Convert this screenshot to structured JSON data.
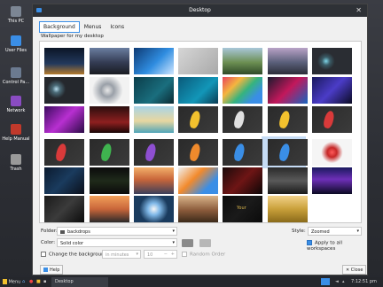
{
  "desktop_icons": [
    {
      "label": "This PC",
      "color": "#7c8694"
    },
    {
      "label": "User Files",
      "color": "#3a8ee6"
    },
    {
      "label": "Control Pa...",
      "color": "#6b7a90"
    },
    {
      "label": "Network",
      "color": "#8a4cc2"
    },
    {
      "label": "Help Manual",
      "color": "#c0392b"
    },
    {
      "label": "Trash",
      "color": "#9a9a9a"
    }
  ],
  "window": {
    "title": "Desktop",
    "tabs": [
      "Background",
      "Menus",
      "Icons"
    ],
    "active_tab": "Background",
    "wallpaper_label": "Wallpaper for my desktop"
  },
  "wallpapers": [
    {
      "name": "city-lights",
      "bg": "linear-gradient(180deg,#0b1526,#23395d 60%,#b37a2c)"
    },
    {
      "name": "mountain-dusk",
      "bg": "linear-gradient(180deg,#6a7ea0,#343c54 55%,#1a1c22)"
    },
    {
      "name": "blue-wave",
      "bg": "linear-gradient(135deg,#0e3a73,#2f8de0 55%,#cfe6ff)"
    },
    {
      "name": "gray-blur",
      "bg": "linear-gradient(135deg,#d6d6d6,#a9a9a9)"
    },
    {
      "name": "green-hills",
      "bg": "linear-gradient(180deg,#a9c7d9,#6c8f52 55%,#2f4a28)"
    },
    {
      "name": "purple-peak",
      "bg": "linear-gradient(180deg,#b9a3c7,#5a5f7a 55%,#2b2d38)"
    },
    {
      "name": "dark-orb",
      "bg": "radial-gradient(circle at 35% 50%,#7fd6e8 0,#3a5b66 14%,#2a2d33 30%)"
    },
    {
      "name": "dark-blue-orb",
      "bg": "radial-gradient(circle at 30% 45%,#b9dff0 0,#4b6b78 12%,#25282d 30%)"
    },
    {
      "name": "robot-hand",
      "bg": "radial-gradient(circle at 45% 50%,#e8e8e8 0,#9aa0a8 25%,#f2f2f2 60%)"
    },
    {
      "name": "teal-dark",
      "bg": "linear-gradient(135deg,#0b3d4a,#1a6e7e 60%,#0b2a33)"
    },
    {
      "name": "teal-blue",
      "bg": "linear-gradient(135deg,#0a5a7a,#1296b8 60%,#0a3b52)"
    },
    {
      "name": "colorful-face",
      "bg": "linear-gradient(135deg,#e8455f,#f4b53f 30%,#36b37e 55%,#3a8ee6 80%)"
    },
    {
      "name": "pink-dots",
      "bg": "linear-gradient(135deg,#1a1a2e,#c2185b 50%,#1565c0)"
    },
    {
      "name": "blue-purple-abstract",
      "bg": "linear-gradient(135deg,#1a1a5e,#4b3cc7 50%,#0b0b24)"
    },
    {
      "name": "magenta-lines",
      "bg": "linear-gradient(135deg,#3a0b5e,#b82fd1 50%,#2b0b46)"
    },
    {
      "name": "red-forest",
      "bg": "linear-gradient(180deg,#2a0e0e,#8e1f1f 60%,#1a0606)"
    },
    {
      "name": "beach",
      "bg": "linear-gradient(180deg,#a8d4e8,#e8d7a0 55%,#4fa4b8)"
    },
    {
      "name": "yellow-stroke",
      "bg": "linear-gradient(135deg,#2a2a2a,#3b3b3b)",
      "accent": "#f2c12e"
    },
    {
      "name": "gray-stroke",
      "bg": "linear-gradient(135deg,#2a2a2a,#3b3b3b)",
      "accent": "#e0e0e0"
    },
    {
      "name": "yellow-stroke-2",
      "bg": "linear-gradient(135deg,#2a2a2a,#3b3b3b)",
      "accent": "#f2c12e"
    },
    {
      "name": "red-stroke",
      "bg": "linear-gradient(135deg,#2a2a2a,#3b3b3b)",
      "accent": "#d93a3a"
    },
    {
      "name": "red-stroke-2",
      "bg": "linear-gradient(135deg,#2a2a2a,#3b3b3b)",
      "accent": "#d93a3a"
    },
    {
      "name": "green-stroke",
      "bg": "linear-gradient(135deg,#2a2a2a,#3b3b3b)",
      "accent": "#3fb34f"
    },
    {
      "name": "purple-stroke",
      "bg": "linear-gradient(135deg,#2a2a2a,#3b3b3b)",
      "accent": "#8e4fd1"
    },
    {
      "name": "orange-stroke",
      "bg": "linear-gradient(135deg,#2a2a2a,#3b3b3b)",
      "accent": "#f08a2c"
    },
    {
      "name": "blue-stroke",
      "bg": "linear-gradient(135deg,#2a2a2a,#3b3b3b)",
      "accent": "#3a8ee6"
    },
    {
      "name": "blue-stroke-selected",
      "bg": "linear-gradient(135deg,#2a2a2a,#3b3b3b)",
      "accent": "#3a8ee6",
      "selected": true
    },
    {
      "name": "red-heart",
      "bg": "radial-gradient(circle at 50% 50%,#ff5a5a 0,#c62828 20%,#f5f5f5 45%)"
    },
    {
      "name": "dark-tech",
      "bg": "linear-gradient(135deg,#0b1a2e,#1a3b5e 50%,#0b0f1a)"
    },
    {
      "name": "code-screen",
      "bg": "linear-gradient(180deg,#0b0b0b,#1f2a1a 50%,#0b0b0b)"
    },
    {
      "name": "sunset-mountain",
      "bg": "linear-gradient(180deg,#f2b06a,#c9663a 45%,#3b3f5a)"
    },
    {
      "name": "orange-feather",
      "bg": "linear-gradient(135deg,#f0f0f0,#f28a2c 40%,#3a8ee6 75%)"
    },
    {
      "name": "dark-red-glow",
      "bg": "linear-gradient(135deg,#1a0b0b,#6e1515 50%,#0b0606)"
    },
    {
      "name": "dark-cave",
      "bg": "linear-gradient(180deg,#2a2a2a,#5a5a5a 50%,#1a1a1a)"
    },
    {
      "name": "city-night-reflection",
      "bg": "linear-gradient(180deg,#1a1a5e,#6e2fb8 45%,#0b0b24)"
    },
    {
      "name": "dark-pattern",
      "bg": "linear-gradient(135deg,#1a1a1a,#3b3b3b 50%,#0b0b0b)"
    },
    {
      "name": "stonehenge",
      "bg": "linear-gradient(180deg,#f2a05a,#c9663a 50%,#2b2a2a)"
    },
    {
      "name": "blue-tunnel",
      "bg": "radial-gradient(circle at 50% 50%,#f5f5f5 0,#7fb8e8 25%,#1a3b5e 60%)"
    },
    {
      "name": "brown-hall",
      "bg": "linear-gradient(180deg,#d9b48a,#8a5a3a 55%,#3b2a1a)"
    },
    {
      "name": "dark-gold",
      "bg": "linear-gradient(135deg,#0b0b0b,#1a1a1a 50%,#0b0b0b)",
      "caption": "Your"
    },
    {
      "name": "golden-field",
      "bg": "linear-gradient(180deg,#f2d28a,#c9a03a 50%,#8a6a1a)"
    }
  ],
  "controls": {
    "folder_label": "Folder:",
    "folder_value": "backdrops",
    "style_label": "Style:",
    "style_value": "Zoomed",
    "color_label": "Color:",
    "color_value": "Solid color",
    "swatch1": "#8a8a8a",
    "swatch2": "#b7b7b7",
    "apply_all_label": "Apply to all workspaces",
    "change_bg_label": "Change the background",
    "interval_unit": "in minutes",
    "interval_value": "10",
    "random_order_label": "Random Order"
  },
  "buttons": {
    "help": "Help",
    "close": "Close"
  },
  "taskbar": {
    "menu_label": "Menu",
    "active_window": "Desktop",
    "clock": "7:12:51 pm"
  }
}
